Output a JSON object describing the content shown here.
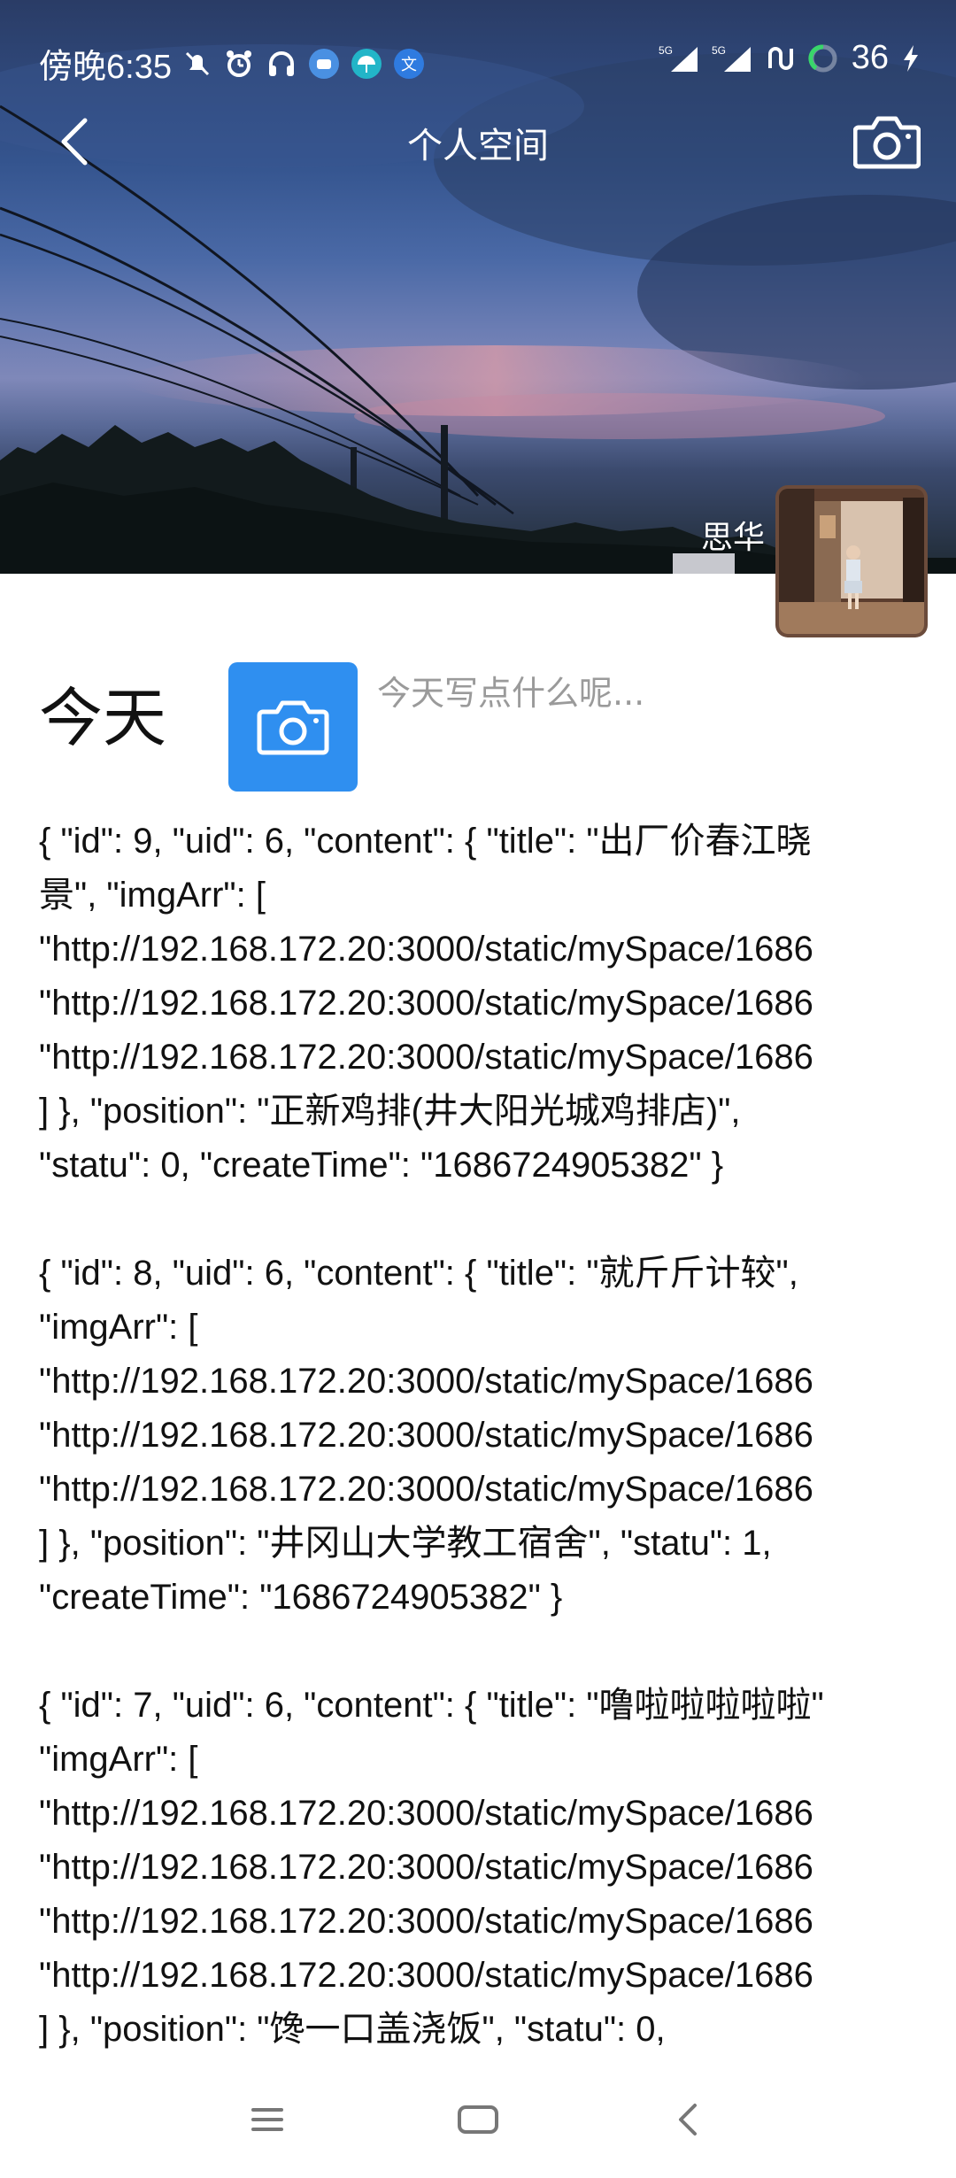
{
  "status_bar": {
    "time": "傍晚6:35",
    "battery": "36",
    "left_icons": [
      "silent-icon",
      "alarm-icon",
      "headphones-icon",
      "app-notify-icon",
      "umbrella-icon",
      "translate-icon"
    ],
    "right_icons": [
      "signal-5g-icon",
      "signal-5g-icon",
      "network-icon",
      "battery-ring-icon",
      "charging-icon"
    ]
  },
  "nav": {
    "title": "个人空间"
  },
  "profile": {
    "username": "思华"
  },
  "composer": {
    "today_label": "今天",
    "placeholder": "今天写点什么呢..."
  },
  "records": [
    {
      "text": "{ \"id\": 9, \"uid\": 6, \"content\": { \"title\": \"出厂价春江晓\n景\", \"imgArr\": [\n\"http://192.168.172.20:3000/static/mySpace/1686\n\"http://192.168.172.20:3000/static/mySpace/1686\n\"http://192.168.172.20:3000/static/mySpace/1686\n] }, \"position\": \"正新鸡排(井大阳光城鸡排店)\",\n\"statu\": 0, \"createTime\": \"1686724905382\" }"
    },
    {
      "text": "{ \"id\": 8, \"uid\": 6, \"content\": { \"title\": \"就斤斤计较\",\n\"imgArr\": [\n\"http://192.168.172.20:3000/static/mySpace/1686\n\"http://192.168.172.20:3000/static/mySpace/1686\n\"http://192.168.172.20:3000/static/mySpace/1686\n] }, \"position\": \"井冈山大学教工宿舍\", \"statu\": 1,\n\"createTime\": \"1686724905382\" }"
    },
    {
      "text": "{ \"id\": 7, \"uid\": 6, \"content\": { \"title\": \"噜啦啦啦啦啦\"\n\"imgArr\": [\n\"http://192.168.172.20:3000/static/mySpace/1686\n\"http://192.168.172.20:3000/static/mySpace/1686\n\"http://192.168.172.20:3000/static/mySpace/1686\n\"http://192.168.172.20:3000/static/mySpace/1686\n] }, \"position\": \"馋一口盖浇饭\", \"statu\": 0,"
    }
  ],
  "system_nav": {
    "icons": [
      "menu-icon",
      "home-icon",
      "back-icon"
    ]
  }
}
